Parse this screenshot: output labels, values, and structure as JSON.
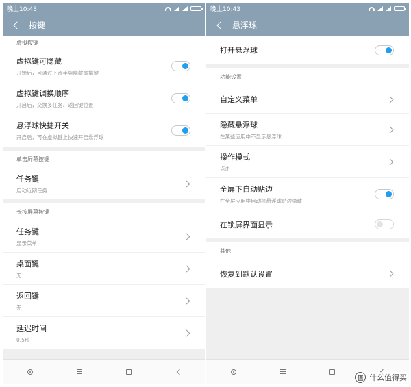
{
  "colors": {
    "header_bg": "#8aa1b4",
    "accent_toggle": "#1e9ff0",
    "page_bg": "#efeff0"
  },
  "left": {
    "statusbar": {
      "time": "晚上10:43"
    },
    "title": "按键",
    "sections": [
      {
        "label": "虚拟按键",
        "rows": [
          {
            "title": "虚拟键可隐藏",
            "sub": "开始后，可通过下滑手势隐藏虚拟键",
            "control": "toggle",
            "on": true
          },
          {
            "title": "虚拟键调换顺序",
            "sub": "开启后，交换多任务、返回键位置",
            "control": "toggle",
            "on": true
          },
          {
            "title": "悬浮球快捷开关",
            "sub": "开启后，可在虚拟键上快速开启悬浮球",
            "control": "toggle",
            "on": true
          }
        ]
      },
      {
        "label": "单击屏幕按键",
        "rows": [
          {
            "title": "任务键",
            "sub": "启动近期任务",
            "control": "chevron"
          }
        ]
      },
      {
        "label": "长按屏幕按键",
        "rows": [
          {
            "title": "任务键",
            "sub": "显示菜单",
            "control": "chevron"
          },
          {
            "title": "桌面键",
            "sub": "无",
            "control": "chevron"
          },
          {
            "title": "返回键",
            "sub": "无",
            "control": "chevron"
          },
          {
            "title": "延迟时间",
            "sub": "0.5秒",
            "control": "chevron"
          }
        ]
      }
    ]
  },
  "right": {
    "statusbar": {
      "time": "晚上10:43"
    },
    "title": "悬浮球",
    "top_row": {
      "title": "打开悬浮球",
      "control": "toggle",
      "on": true
    },
    "sections": [
      {
        "label": "功能设置",
        "rows": [
          {
            "title": "自定义菜单",
            "sub": "",
            "control": "chevron"
          },
          {
            "title": "隐藏悬浮球",
            "sub": "在某些应用中不显示悬浮球",
            "control": "chevron"
          },
          {
            "title": "操作模式",
            "sub": "点击",
            "control": "chevron"
          },
          {
            "title": "全屏下自动贴边",
            "sub": "在全屏应用中自动将悬浮球贴边隐藏",
            "control": "toggle",
            "on": true
          },
          {
            "title": "在锁屏界面显示",
            "sub": "",
            "control": "toggle",
            "on": false
          }
        ]
      },
      {
        "label": "其他",
        "rows": [
          {
            "title": "恢复到默认设置",
            "sub": "",
            "control": "chevron"
          }
        ]
      }
    ]
  },
  "watermark": {
    "logo": "值",
    "text": "什么值得买"
  }
}
